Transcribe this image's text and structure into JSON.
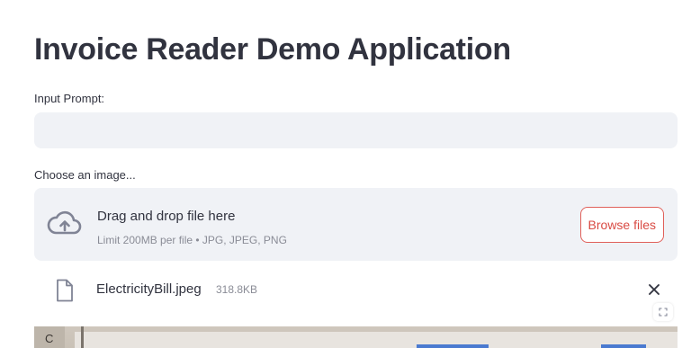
{
  "page": {
    "title": "Invoice Reader Demo Application"
  },
  "prompt": {
    "label": "Input Prompt:",
    "value": "",
    "placeholder": ""
  },
  "uploader": {
    "label": "Choose an image...",
    "drop_title": "Drag and drop file here",
    "limit_text": "Limit 200MB per file • JPG, JPEG, PNG",
    "browse_label": "Browse files",
    "icon": "cloud-upload-icon"
  },
  "uploaded_file": {
    "name": "ElectricityBill.jpeg",
    "size": "318.8KB",
    "icon": "file-icon",
    "remove_icon": "close-icon"
  },
  "preview": {
    "visible_letter": "C"
  },
  "colors": {
    "accent": "#d94a43",
    "input_bg": "#f0f2f6",
    "text": "#31333f",
    "muted": "#8a8c96"
  }
}
